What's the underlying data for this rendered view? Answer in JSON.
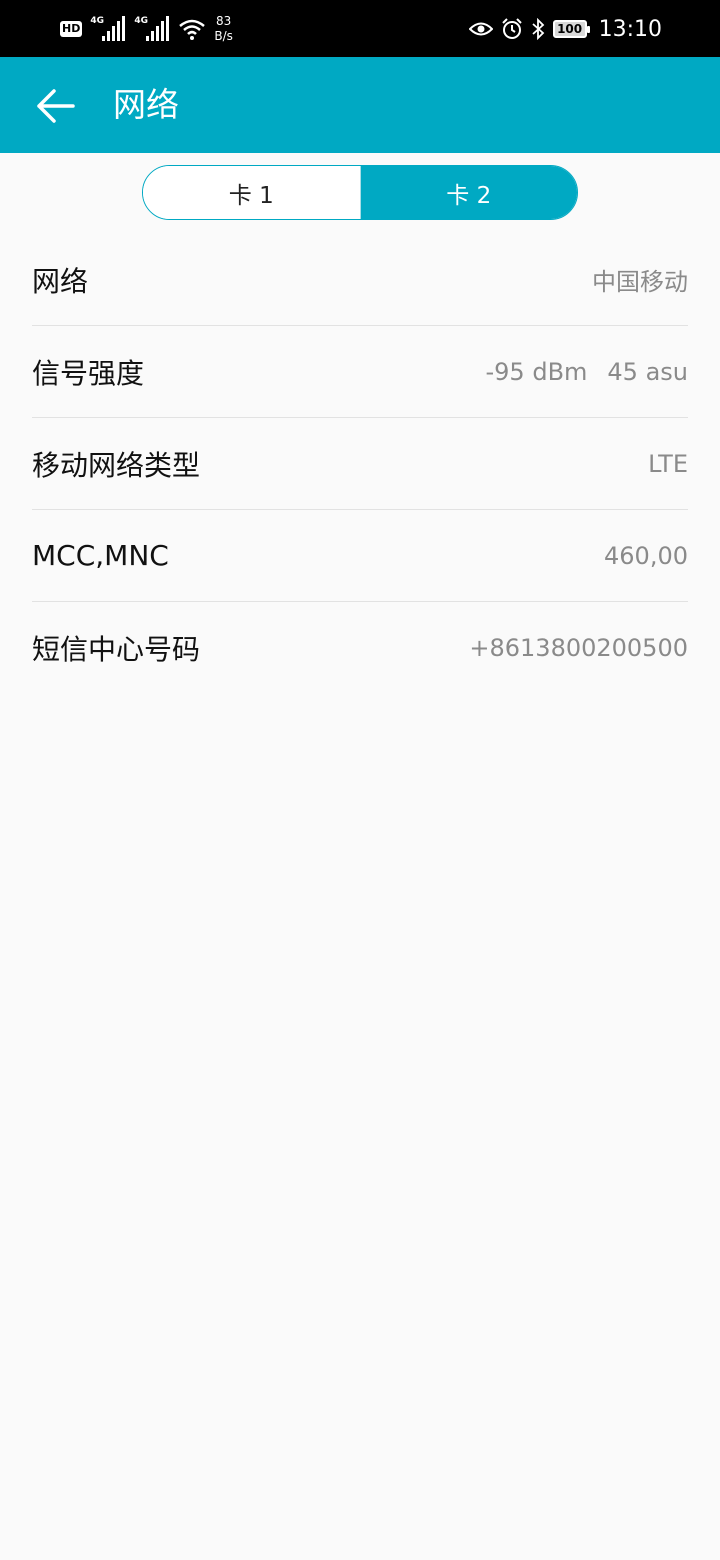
{
  "status_bar": {
    "hd_badge": "HD",
    "network_1": "4G",
    "network_2": "4G",
    "speed_value": "83",
    "speed_unit": "B/s",
    "battery": "100",
    "time": "13:10",
    "icons": [
      "hd-icon",
      "signal-icon",
      "wifi-icon",
      "eye-icon",
      "alarm-icon",
      "bluetooth-icon",
      "battery-icon"
    ]
  },
  "app_bar": {
    "title": "网络",
    "back_icon": "arrow-left-icon",
    "background": "#00a9c3"
  },
  "sim_tabs": {
    "tabs": [
      {
        "label": "卡 1",
        "selected": false
      },
      {
        "label": "卡 2",
        "selected": true
      }
    ]
  },
  "info_rows": [
    {
      "label": "网络",
      "value": "中国移动"
    },
    {
      "label": "信号强度",
      "value_dbm": "-95 dBm",
      "value_asu": "45 asu"
    },
    {
      "label": "移动网络类型",
      "value": "LTE"
    },
    {
      "label": "MCC,MNC",
      "value": "460,00"
    },
    {
      "label": "短信中心号码",
      "value": "+8613800200500"
    }
  ]
}
